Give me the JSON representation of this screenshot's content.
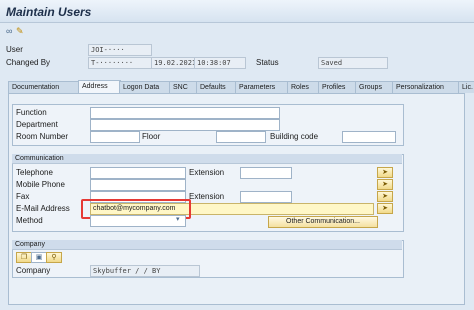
{
  "window": {
    "title": "Maintain Users"
  },
  "toolbar": {
    "icons": [
      "glasses-icon",
      "pencil-settings-icon"
    ]
  },
  "header": {
    "user_label": "User",
    "user_value": "JOI-····",
    "changed_by_label": "Changed By",
    "changed_by_value": "T-········",
    "date_value": "19.02.2021",
    "time_value": "10:38:07",
    "status_label": "Status",
    "status_value": "Saved"
  },
  "tabs": [
    {
      "label": "Documentation"
    },
    {
      "label": "Address"
    },
    {
      "label": "Logon Data"
    },
    {
      "label": "SNC"
    },
    {
      "label": "Defaults"
    },
    {
      "label": "Parameters"
    },
    {
      "label": "Roles"
    },
    {
      "label": "Profiles"
    },
    {
      "label": "Groups"
    },
    {
      "label": "Personalization"
    },
    {
      "label": "Lic. D"
    }
  ],
  "active_tab": "Address",
  "address": {
    "function_label": "Function",
    "department_label": "Department",
    "room_label": "Room Number",
    "floor_label": "Floor",
    "building_label": "Building code"
  },
  "communication": {
    "title": "Communication",
    "telephone_label": "Telephone",
    "extension_label": "Extension",
    "mobile_label": "Mobile Phone",
    "fax_label": "Fax",
    "fax_extension_label": "Extension",
    "email_label": "E-Mail Address",
    "email_value": "chatbot@mycompany.com",
    "method_label": "Method",
    "other_button": "Other Communication..."
  },
  "company": {
    "title": "Company",
    "label": "Company",
    "value": "Skybuffer  /  / BY"
  },
  "colors": {
    "highlight": "#e53935",
    "accent": "#f1d98a"
  }
}
